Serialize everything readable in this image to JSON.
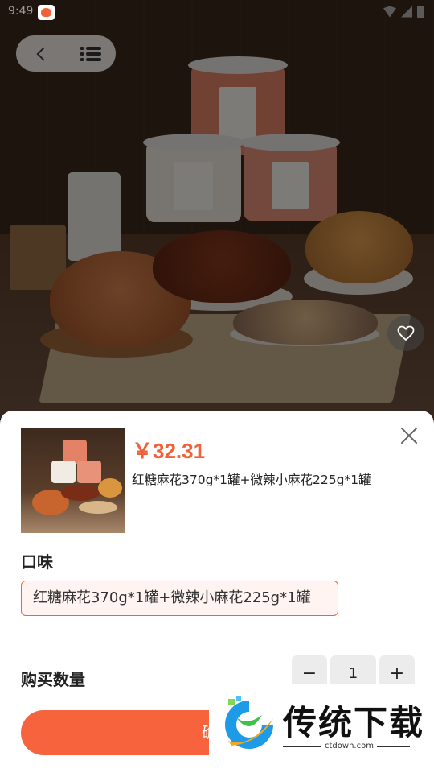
{
  "status_bar": {
    "time": "9:49",
    "notification_icon": "app-heart-icon",
    "icons": [
      "wifi-icon",
      "signal-icon",
      "battery-icon"
    ]
  },
  "nav": {
    "back_icon": "back-chevron-icon",
    "menu_icon": "list-menu-icon"
  },
  "hero": {
    "favorite_icon": "heart-outline-icon"
  },
  "sheet": {
    "price": "￥32.31",
    "sku_title": "红糖麻花370g*1罐+微辣小麻花225g*1罐",
    "close_icon": "close-icon",
    "flavor_label": "口味",
    "flavor_options": [
      {
        "label": "红糖麻花370g*1罐+微辣小麻花225g*1罐",
        "selected": true
      }
    ],
    "quantity_label": "购买数量",
    "quantity": {
      "minus": "−",
      "value": "1",
      "plus": "+"
    },
    "confirm_label": "确定"
  },
  "watermark": {
    "brand": "传统下载",
    "domain": "ctdown.com"
  },
  "colors": {
    "accent": "#f0623a",
    "button": "#f7633d",
    "chip_bg": "#fff4f1"
  }
}
